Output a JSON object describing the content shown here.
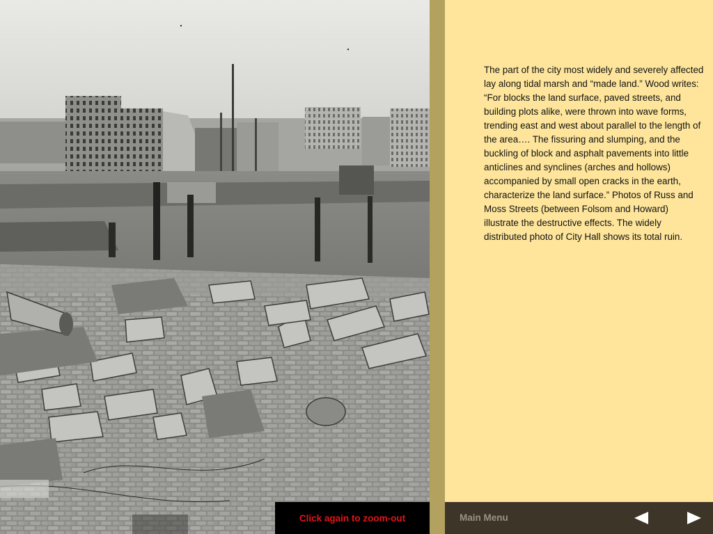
{
  "article": {
    "body": "The part of the city most widely and severely affected lay along tidal marsh and “made land.” Wood writes: “For blocks the land surface, paved streets, and building plots alike, were thrown into wave forms, trending east and west about parallel to the length of the area…. The fissuring and slumping, and the buckling of block and asphalt pavements into little anticlines and synclines (arches and hollows) accompanied by small open cracks in the earth, characterize the land surface.” Photos of Russ and Moss Streets (between Folsom and Howard) illustrate the destructive effects. The widely distributed photo of City Hall shows its total ruin."
  },
  "photo": {
    "subject": "earthquake-ruins-photo"
  },
  "controls": {
    "zoom_out_label": "Click again to zoom-out",
    "main_menu_label": "Main Menu",
    "prev_icon": "triangle-left-icon",
    "next_icon": "triangle-right-icon"
  },
  "colors": {
    "text_panel_bg": "#fee59b",
    "gutter": "#b3a15f",
    "nav_bar_bg": "#3d3528",
    "zoom_bar_bg": "#000000",
    "zoom_label": "#e0141b",
    "main_menu_label": "#9a9384",
    "nav_arrow": "#ffffff"
  }
}
